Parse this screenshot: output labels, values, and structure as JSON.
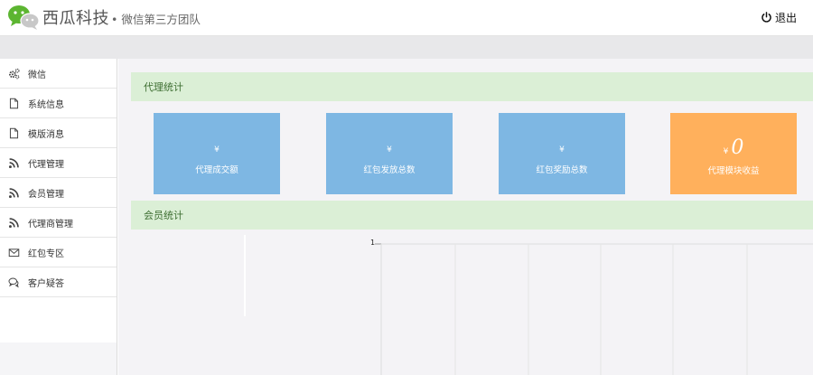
{
  "header": {
    "brand": "西瓜科技",
    "subtitle": "• 微信第三方团队",
    "logout_label": "退出",
    "logo_icon": "wechat-logo-icon",
    "logout_icon": "power-icon"
  },
  "sidebar": {
    "items": [
      {
        "label": "微信",
        "icon": "gears-icon"
      },
      {
        "label": "系统信息",
        "icon": "file-icon"
      },
      {
        "label": "模版消息",
        "icon": "file-icon"
      },
      {
        "label": "代理管理",
        "icon": "rss-icon"
      },
      {
        "label": "会员管理",
        "icon": "rss-icon"
      },
      {
        "label": "代理商管理",
        "icon": "rss-icon"
      },
      {
        "label": "红包专区",
        "icon": "envelope-icon"
      },
      {
        "label": "客户疑答",
        "icon": "comments-icon"
      }
    ]
  },
  "main": {
    "agent_stats_title": "代理统计",
    "member_stats_title": "会员统计",
    "cards": [
      {
        "currency": "¥",
        "label": "代理成交额",
        "color": "#7eb7e3"
      },
      {
        "currency": "¥",
        "label": "红包发放总数",
        "color": "#7eb7e3"
      },
      {
        "currency": "¥",
        "label": "红包奖励总数",
        "color": "#7eb7e3"
      },
      {
        "currency": "¥",
        "value": "0",
        "label": "代理模块收益",
        "color": "#ffb05c"
      }
    ],
    "chart": {
      "y_tick": "1"
    }
  }
}
